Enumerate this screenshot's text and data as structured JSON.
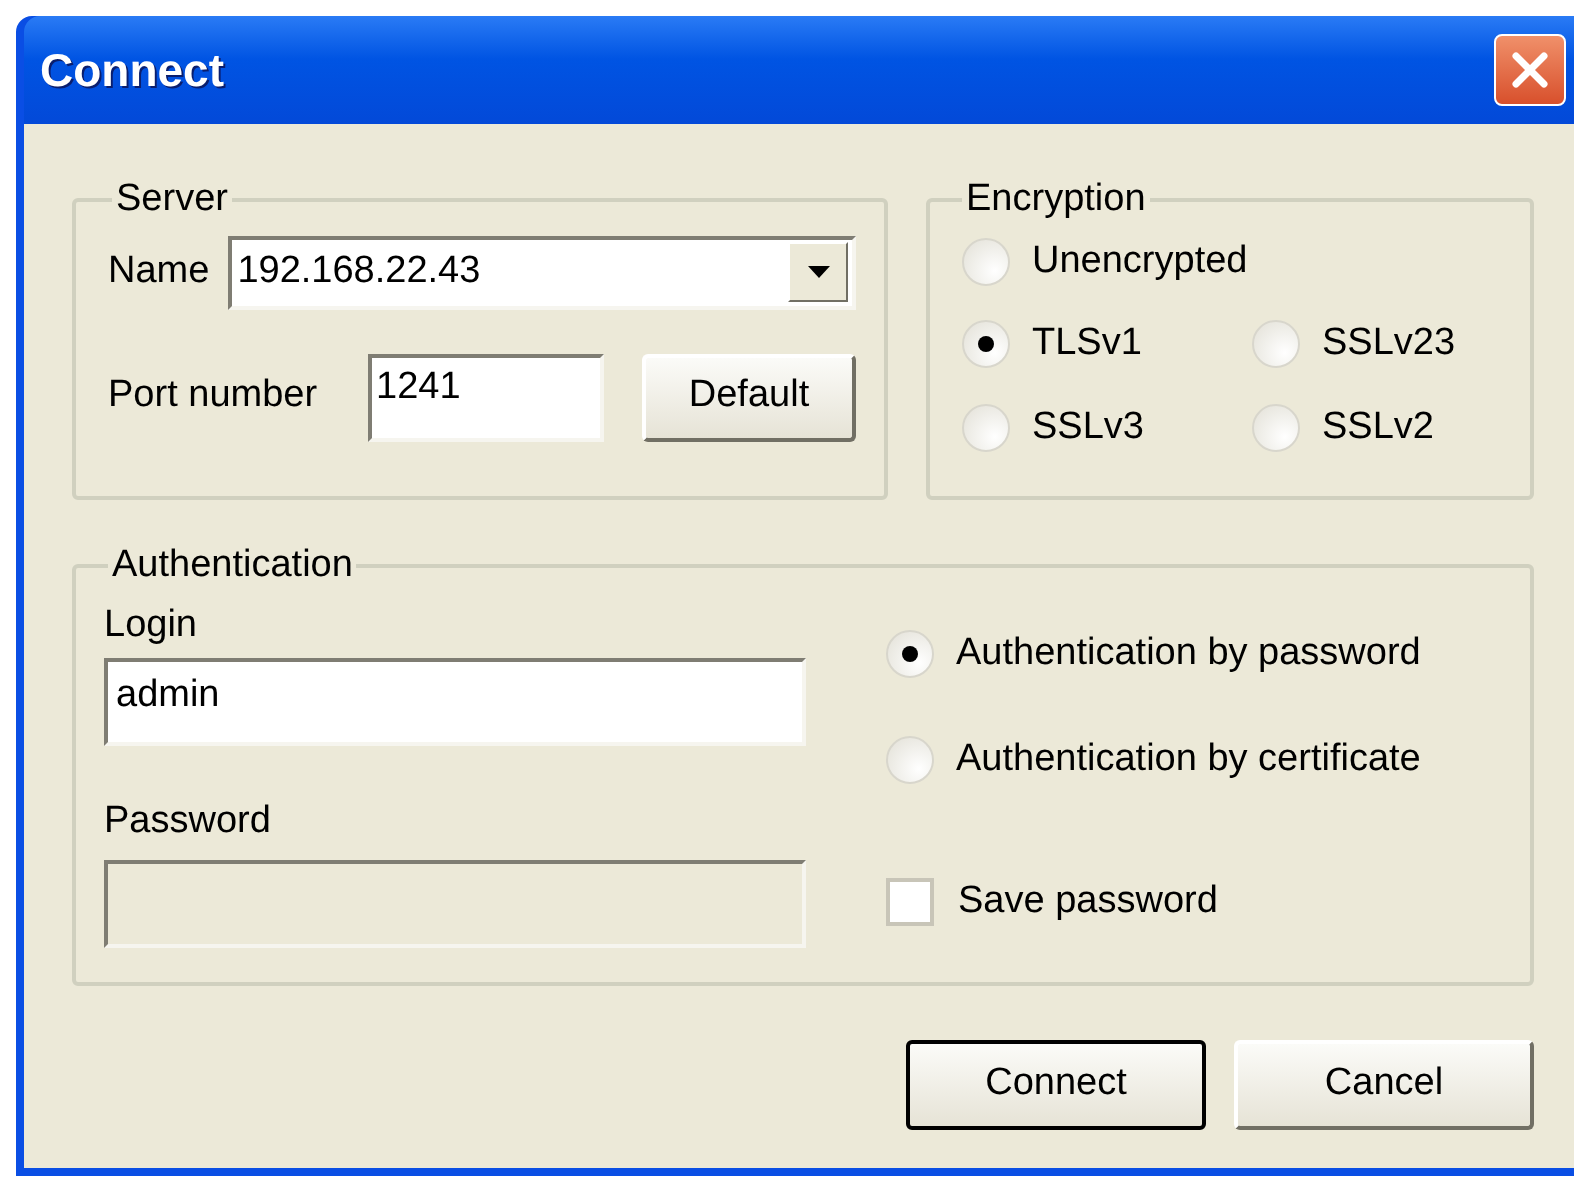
{
  "window": {
    "title": "Connect"
  },
  "server": {
    "title": "Server",
    "name_label": "Name",
    "name_value": "192.168.22.43",
    "port_label": "Port number",
    "port_value": "1241",
    "default_button": "Default"
  },
  "encryption": {
    "title": "Encryption",
    "options": [
      {
        "label": "Unencrypted",
        "selected": false
      },
      {
        "label": "TLSv1",
        "selected": true
      },
      {
        "label": "SSLv23",
        "selected": false
      },
      {
        "label": "SSLv3",
        "selected": false
      },
      {
        "label": "SSLv2",
        "selected": false
      }
    ]
  },
  "authentication": {
    "title": "Authentication",
    "login_label": "Login",
    "login_value": "admin",
    "password_label": "Password",
    "password_disabled": true,
    "methods": [
      {
        "label": "Authentication by password",
        "selected": true
      },
      {
        "label": "Authentication by certificate",
        "selected": false
      }
    ],
    "save_password": {
      "label": "Save password",
      "checked": false
    }
  },
  "buttons": [
    {
      "label": "Connect",
      "default": true
    },
    {
      "label": "Cancel",
      "default": false
    }
  ]
}
